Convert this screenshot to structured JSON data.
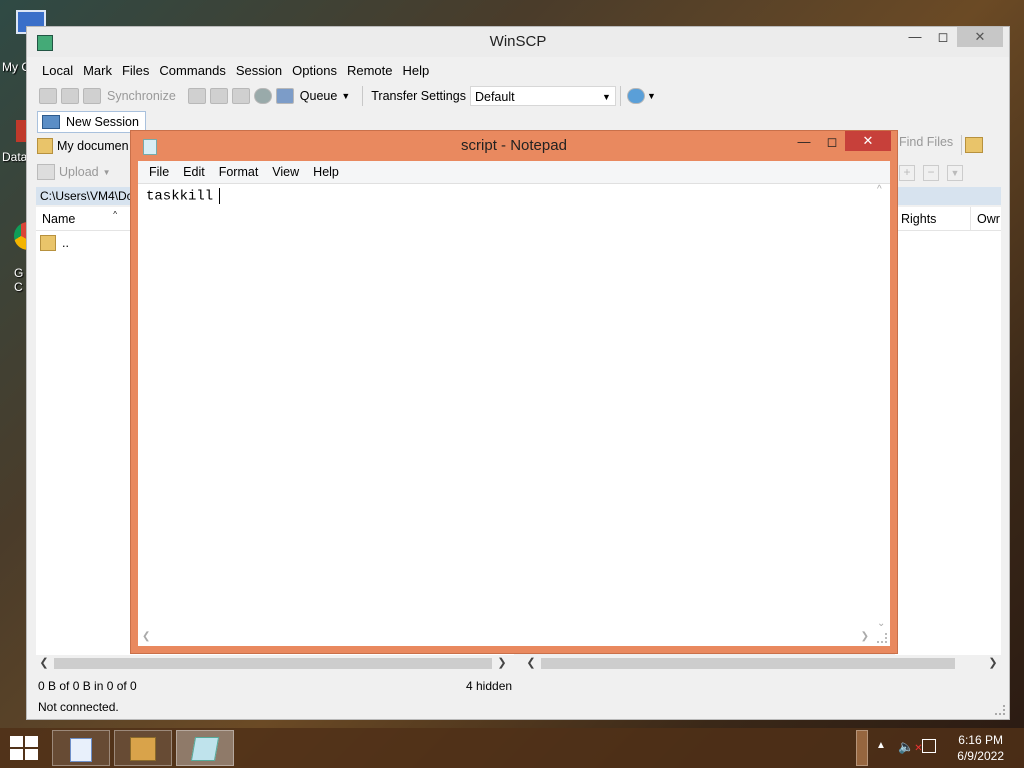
{
  "desktop": {
    "icons": [
      {
        "label": "My C",
        "icon": "computer-icon"
      },
      {
        "label": "Data",
        "icon": "database-icon"
      },
      {
        "label": "G C",
        "icon": "chrome-icon"
      }
    ]
  },
  "winscp": {
    "title": "WinSCP",
    "menu": [
      "Local",
      "Mark",
      "Files",
      "Commands",
      "Session",
      "Options",
      "Remote",
      "Help"
    ],
    "toolbar": {
      "synchronize": "Synchronize",
      "queue": "Queue",
      "transfer_settings_label": "Transfer Settings",
      "transfer_settings_value": "Default"
    },
    "new_session": "New Session",
    "local_panel": {
      "location": "My documen",
      "upload": "Upload",
      "path": "C:\\Users\\VM4\\Dc",
      "column_name": "Name",
      "parent_dir": ".."
    },
    "remote_panel": {
      "find_files": "Find Files",
      "col_rights": "Rights",
      "col_owner": "Owr"
    },
    "status": {
      "selection": "0 B of 0 B in 0 of 0",
      "hidden": "4 hidden",
      "connection": "Not connected."
    }
  },
  "notepad": {
    "title": "script - Notepad",
    "menu": [
      "File",
      "Edit",
      "Format",
      "View",
      "Help"
    ],
    "content": "taskkill"
  },
  "taskbar": {
    "time": "6:16 PM",
    "date": "6/9/2022",
    "apps": [
      "wordpad-icon",
      "package-icon",
      "notepad-icon"
    ]
  }
}
